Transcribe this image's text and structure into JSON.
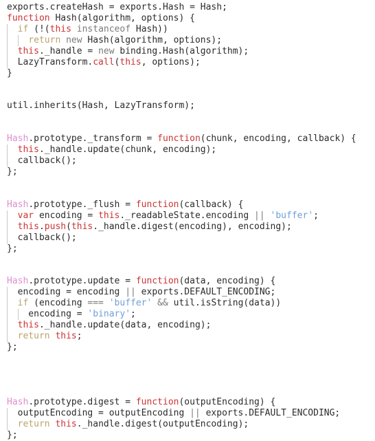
{
  "editor": {
    "language": "javascript",
    "background_color": "#ffffff",
    "default_text_color": "#2b2b2b",
    "font_size_px": 13,
    "line_height_px": 16,
    "indent_guide_color": "#c8c8c8",
    "theme_colors": {
      "keyword": "#cc3333",
      "keyword_control": "#b9a36a",
      "class_name": "#dd8fcc",
      "string": "#6f9fd8",
      "operator": "#7a7a7a",
      "plain": "#2b2b2b"
    }
  },
  "code": {
    "lines": [
      {
        "indent": 0,
        "tokens": [
          {
            "t": "exports.createHash = exports.Hash = Hash;",
            "c": "plain"
          }
        ]
      },
      {
        "indent": 0,
        "tokens": [
          {
            "t": "function",
            "c": "kw"
          },
          {
            "t": " Hash(algorithm, options) {",
            "c": "plain"
          }
        ]
      },
      {
        "indent": 1,
        "tokens": [
          {
            "t": "  ",
            "c": "plain"
          },
          {
            "t": "if",
            "c": "kw2"
          },
          {
            "t": " (!(",
            "c": "plain"
          },
          {
            "t": "this",
            "c": "kw"
          },
          {
            "t": " ",
            "c": "plain"
          },
          {
            "t": "instanceof",
            "c": "op"
          },
          {
            "t": " Hash))",
            "c": "plain"
          }
        ]
      },
      {
        "indent": 2,
        "tokens": [
          {
            "t": "    ",
            "c": "plain"
          },
          {
            "t": "return",
            "c": "kw2"
          },
          {
            "t": " ",
            "c": "plain"
          },
          {
            "t": "new",
            "c": "op"
          },
          {
            "t": " Hash(algorithm, options);",
            "c": "plain"
          }
        ]
      },
      {
        "indent": 1,
        "tokens": [
          {
            "t": "  ",
            "c": "plain"
          },
          {
            "t": "this",
            "c": "kw"
          },
          {
            "t": "._handle = ",
            "c": "plain"
          },
          {
            "t": "new",
            "c": "op"
          },
          {
            "t": " binding.Hash(algorithm);",
            "c": "plain"
          }
        ]
      },
      {
        "indent": 1,
        "tokens": [
          {
            "t": "  LazyTransform.",
            "c": "plain"
          },
          {
            "t": "call",
            "c": "kw"
          },
          {
            "t": "(",
            "c": "plain"
          },
          {
            "t": "this",
            "c": "kw"
          },
          {
            "t": ", options);",
            "c": "plain"
          }
        ]
      },
      {
        "indent": 0,
        "tokens": [
          {
            "t": "}",
            "c": "plain"
          }
        ]
      },
      {
        "indent": 0,
        "tokens": []
      },
      {
        "indent": 0,
        "tokens": []
      },
      {
        "indent": 0,
        "tokens": [
          {
            "t": "util.inherits(Hash, LazyTransform);",
            "c": "plain"
          }
        ]
      },
      {
        "indent": 0,
        "tokens": []
      },
      {
        "indent": 0,
        "tokens": []
      },
      {
        "indent": 0,
        "tokens": [
          {
            "t": "Hash",
            "c": "class"
          },
          {
            "t": ".prototype._transform = ",
            "c": "plain"
          },
          {
            "t": "function",
            "c": "kw"
          },
          {
            "t": "(chunk, encoding, callback) {",
            "c": "plain"
          }
        ]
      },
      {
        "indent": 1,
        "tokens": [
          {
            "t": "  ",
            "c": "plain"
          },
          {
            "t": "this",
            "c": "kw"
          },
          {
            "t": "._handle.update(chunk, encoding);",
            "c": "plain"
          }
        ]
      },
      {
        "indent": 1,
        "tokens": [
          {
            "t": "  callback();",
            "c": "plain"
          }
        ]
      },
      {
        "indent": 0,
        "tokens": [
          {
            "t": "};",
            "c": "plain"
          }
        ]
      },
      {
        "indent": 0,
        "tokens": []
      },
      {
        "indent": 0,
        "tokens": []
      },
      {
        "indent": 0,
        "tokens": [
          {
            "t": "Hash",
            "c": "class"
          },
          {
            "t": ".prototype._flush = ",
            "c": "plain"
          },
          {
            "t": "function",
            "c": "kw"
          },
          {
            "t": "(callback) {",
            "c": "plain"
          }
        ]
      },
      {
        "indent": 1,
        "tokens": [
          {
            "t": "  ",
            "c": "plain"
          },
          {
            "t": "var",
            "c": "kw"
          },
          {
            "t": " encoding = ",
            "c": "plain"
          },
          {
            "t": "this",
            "c": "kw"
          },
          {
            "t": "._readableState.encoding ",
            "c": "plain"
          },
          {
            "t": "||",
            "c": "op"
          },
          {
            "t": " ",
            "c": "plain"
          },
          {
            "t": "'buffer'",
            "c": "str"
          },
          {
            "t": ";",
            "c": "plain"
          }
        ]
      },
      {
        "indent": 1,
        "tokens": [
          {
            "t": "  ",
            "c": "plain"
          },
          {
            "t": "this",
            "c": "kw"
          },
          {
            "t": ".",
            "c": "plain"
          },
          {
            "t": "push",
            "c": "kw"
          },
          {
            "t": "(",
            "c": "plain"
          },
          {
            "t": "this",
            "c": "kw"
          },
          {
            "t": "._handle.digest(encoding), encoding);",
            "c": "plain"
          }
        ]
      },
      {
        "indent": 1,
        "tokens": [
          {
            "t": "  callback();",
            "c": "plain"
          }
        ]
      },
      {
        "indent": 0,
        "tokens": [
          {
            "t": "};",
            "c": "plain"
          }
        ]
      },
      {
        "indent": 0,
        "tokens": []
      },
      {
        "indent": 0,
        "tokens": []
      },
      {
        "indent": 0,
        "tokens": [
          {
            "t": "Hash",
            "c": "class"
          },
          {
            "t": ".prototype.update = ",
            "c": "plain"
          },
          {
            "t": "function",
            "c": "kw"
          },
          {
            "t": "(data, encoding) {",
            "c": "plain"
          }
        ]
      },
      {
        "indent": 1,
        "tokens": [
          {
            "t": "  encoding = encoding ",
            "c": "plain"
          },
          {
            "t": "||",
            "c": "op"
          },
          {
            "t": " exports.DEFAULT_ENCODING;",
            "c": "plain"
          }
        ]
      },
      {
        "indent": 1,
        "tokens": [
          {
            "t": "  ",
            "c": "plain"
          },
          {
            "t": "if",
            "c": "kw2"
          },
          {
            "t": " (encoding ",
            "c": "plain"
          },
          {
            "t": "===",
            "c": "op"
          },
          {
            "t": " ",
            "c": "plain"
          },
          {
            "t": "'buffer'",
            "c": "str"
          },
          {
            "t": " ",
            "c": "plain"
          },
          {
            "t": "&&",
            "c": "op"
          },
          {
            "t": " util.isString(data))",
            "c": "plain"
          }
        ]
      },
      {
        "indent": 2,
        "tokens": [
          {
            "t": "    encoding = ",
            "c": "plain"
          },
          {
            "t": "'binary'",
            "c": "str"
          },
          {
            "t": ";",
            "c": "plain"
          }
        ]
      },
      {
        "indent": 1,
        "tokens": [
          {
            "t": "  ",
            "c": "plain"
          },
          {
            "t": "this",
            "c": "kw"
          },
          {
            "t": "._handle.update(data, encoding);",
            "c": "plain"
          }
        ]
      },
      {
        "indent": 1,
        "tokens": [
          {
            "t": "  ",
            "c": "plain"
          },
          {
            "t": "return",
            "c": "kw2"
          },
          {
            "t": " ",
            "c": "plain"
          },
          {
            "t": "this",
            "c": "kw"
          },
          {
            "t": ";",
            "c": "plain"
          }
        ]
      },
      {
        "indent": 0,
        "tokens": [
          {
            "t": "};",
            "c": "plain"
          }
        ]
      },
      {
        "indent": 0,
        "tokens": []
      },
      {
        "indent": 0,
        "tokens": []
      },
      {
        "indent": 0,
        "tokens": []
      },
      {
        "indent": 0,
        "tokens": []
      },
      {
        "indent": 0,
        "tokens": [
          {
            "t": "Hash",
            "c": "class"
          },
          {
            "t": ".prototype.digest = ",
            "c": "plain"
          },
          {
            "t": "function",
            "c": "kw"
          },
          {
            "t": "(outputEncoding) {",
            "c": "plain"
          }
        ]
      },
      {
        "indent": 1,
        "tokens": [
          {
            "t": "  outputEncoding = outputEncoding ",
            "c": "plain"
          },
          {
            "t": "||",
            "c": "op"
          },
          {
            "t": " exports.DEFAULT_ENCODING;",
            "c": "plain"
          }
        ]
      },
      {
        "indent": 1,
        "tokens": [
          {
            "t": "  ",
            "c": "plain"
          },
          {
            "t": "return",
            "c": "kw2"
          },
          {
            "t": " ",
            "c": "plain"
          },
          {
            "t": "this",
            "c": "kw"
          },
          {
            "t": "._handle.digest(outputEncoding);",
            "c": "plain"
          }
        ]
      },
      {
        "indent": 0,
        "tokens": [
          {
            "t": "};",
            "c": "plain"
          }
        ]
      }
    ]
  }
}
